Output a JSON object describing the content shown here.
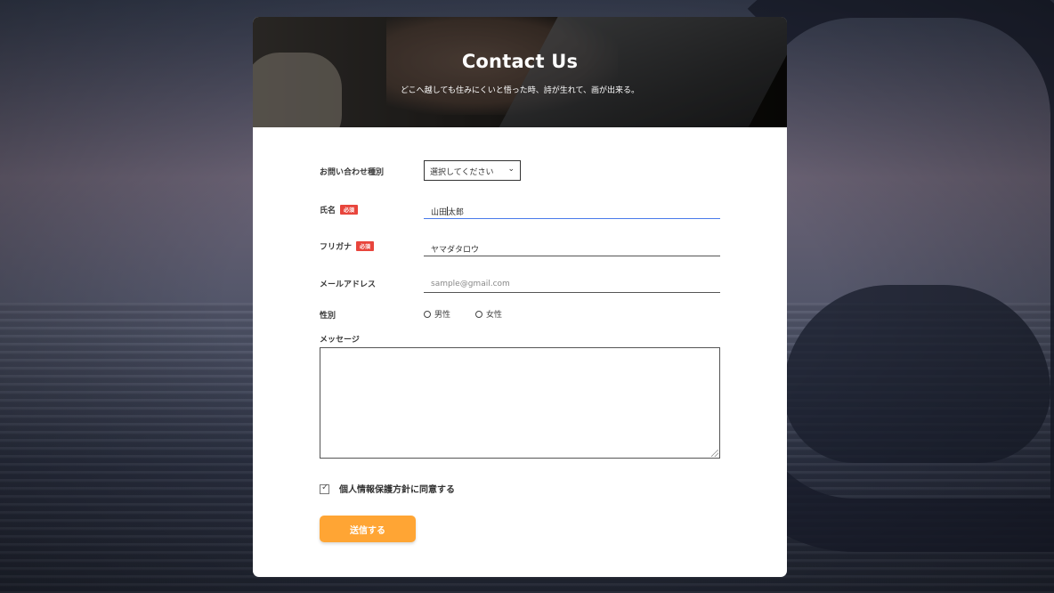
{
  "hero": {
    "title": "Contact Us",
    "subtitle": "どこへ越しても住みにくいと悟った時、詩が生れて、画が出来る。"
  },
  "form": {
    "inquiry_type": {
      "label": "お問い合わせ種別",
      "selected": "選択してください"
    },
    "name": {
      "label": "氏名",
      "badge": "必須",
      "value_before_caret": "山田",
      "value_after_caret": "太郎"
    },
    "furigana": {
      "label": "フリガナ",
      "badge": "必須",
      "value": "ヤマダタロウ"
    },
    "email": {
      "label": "メールアドレス",
      "placeholder": "sample@gmail.com"
    },
    "gender": {
      "label": "性別",
      "options": [
        "男性",
        "女性"
      ]
    },
    "message": {
      "label": "メッセージ",
      "value": ""
    },
    "privacy": {
      "label": "個人情報保護方針に同意する",
      "checked": true
    },
    "submit_label": "送信する"
  },
  "colors": {
    "accent_button": "#ffa534",
    "required_badge": "#e8453c",
    "focus_underline": "#4a7bea"
  },
  "icons": {
    "select_chevron": "chevron-down-icon",
    "checkbox_tick": "checkmark-icon"
  }
}
